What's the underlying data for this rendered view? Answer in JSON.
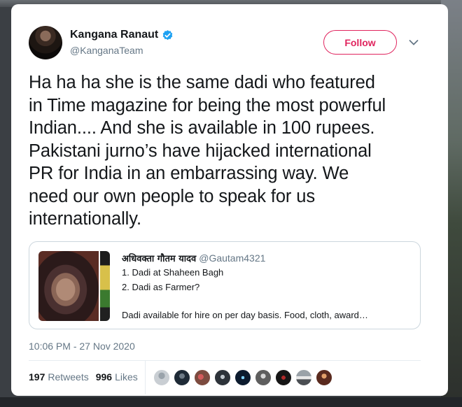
{
  "tweet": {
    "author": {
      "name": "Kangana Ranaut",
      "handle": "@KanganaTeam",
      "verified": true
    },
    "follow_label": "Follow",
    "text_lines": [
      "Ha ha ha she is the same dadi who featured",
      "in Time magazine for being the most powerful",
      "Indian.... And she is available in 100 rupees.",
      "Pakistani jurno’s have hijacked international",
      "PR for India in an embarrassing way. We",
      "need our own people to speak for us",
      "internationally."
    ],
    "quote": {
      "name": "अधिवक्ता गौतम यादव",
      "handle": "@Gautam4321",
      "lines": [
        "1. Dadi at Shaheen Bagh",
        "2. Dadi as Farmer?",
        "",
        "Dadi available for hire on per day basis. Food, cloth, award…"
      ]
    },
    "timestamp": "10:06 PM - 27 Nov 2020",
    "stats": {
      "retweets_count": "197",
      "retweets_label": "Retweets",
      "likes_count": "996",
      "likes_label": "Likes"
    }
  },
  "colors": {
    "follow_accent": "#e0245e",
    "verified_blue": "#1da1f2",
    "secondary_text": "#657786"
  },
  "icons": [
    "verified-badge-icon",
    "chevron-down-icon"
  ]
}
